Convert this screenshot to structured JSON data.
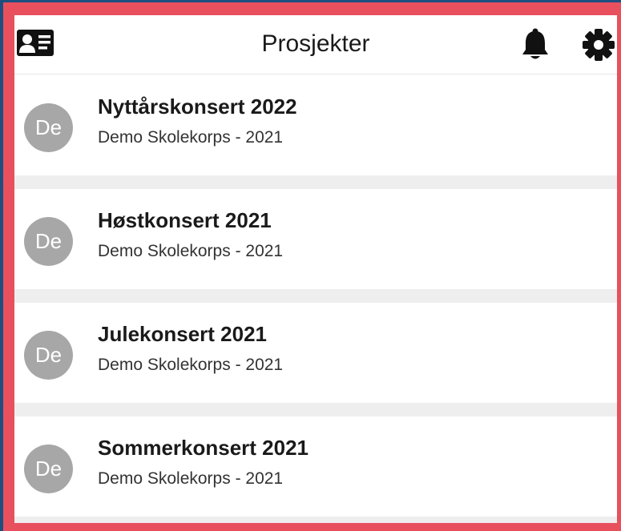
{
  "header": {
    "title": "Prosjekter",
    "icons": {
      "left": "contact-card-icon",
      "right": [
        "bell-icon",
        "gear-icon"
      ]
    }
  },
  "projects": [
    {
      "avatar": "De",
      "title": "Nyttårskonsert 2022",
      "subtitle": "Demo Skolekorps - 2021"
    },
    {
      "avatar": "De",
      "title": "Høstkonsert 2021",
      "subtitle": "Demo Skolekorps - 2021"
    },
    {
      "avatar": "De",
      "title": "Julekonsert 2021",
      "subtitle": "Demo Skolekorps - 2021"
    },
    {
      "avatar": "De",
      "title": "Sommerkonsert 2021",
      "subtitle": "Demo Skolekorps - 2021"
    }
  ],
  "colors": {
    "background": "#1d4e80",
    "frame": "#e9505e",
    "avatar": "#a7a7a7",
    "separator": "#eeeeee"
  }
}
